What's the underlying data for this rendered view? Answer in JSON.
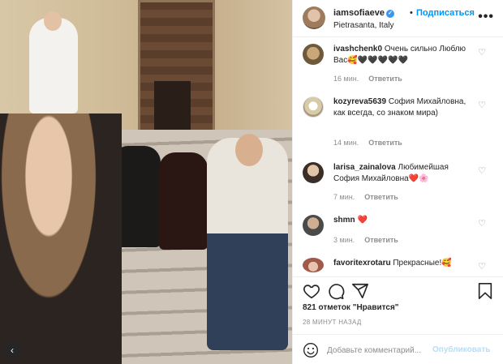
{
  "post": {
    "username": "iamsofiaeve",
    "follow_label": "Подписаться",
    "location": "Pietrasanta, Italy",
    "more_label": "•••",
    "separator": "•"
  },
  "comments": [
    {
      "username": "ivashchenk0",
      "text": "Очень сильно Люблю Вас🥰🖤🖤🖤🖤🖤",
      "time": "16 мин.",
      "reply": "Ответить"
    },
    {
      "username": "kozyreva5639",
      "text": "София Михайловна, как всегда, со знаком мира)",
      "time": "14 мин.",
      "reply": "Ответить"
    },
    {
      "username": "larisa_zainalova",
      "text": "Любимейшая София Михайловна❤️🌸",
      "time": "7 мин.",
      "reply": "Ответить"
    },
    {
      "username": "shmn",
      "text": "❤️",
      "time": "3 мин.",
      "reply": "Ответить"
    },
    {
      "username": "favoritexrotaru",
      "text": "Прекрасные!🥰",
      "time": "",
      "reply": ""
    }
  ],
  "likes": "821 отметок \"Нравится\"",
  "time_ago": "28 МИНУТ НАЗАД",
  "comment_box": {
    "placeholder": "Добавьте комментарий...",
    "post_label": "Опубликовать"
  },
  "photo": {
    "nav_label": "‹"
  },
  "colors": {
    "accent": "#0095f6",
    "muted": "#8e8e8e",
    "text": "#262626",
    "heart": "#ed4956",
    "post_disabled": "#b2dffc"
  },
  "icons": [
    "verified-icon",
    "more-icon",
    "heart-icon",
    "comment-icon",
    "share-icon",
    "bookmark-icon",
    "emoji-icon"
  ]
}
